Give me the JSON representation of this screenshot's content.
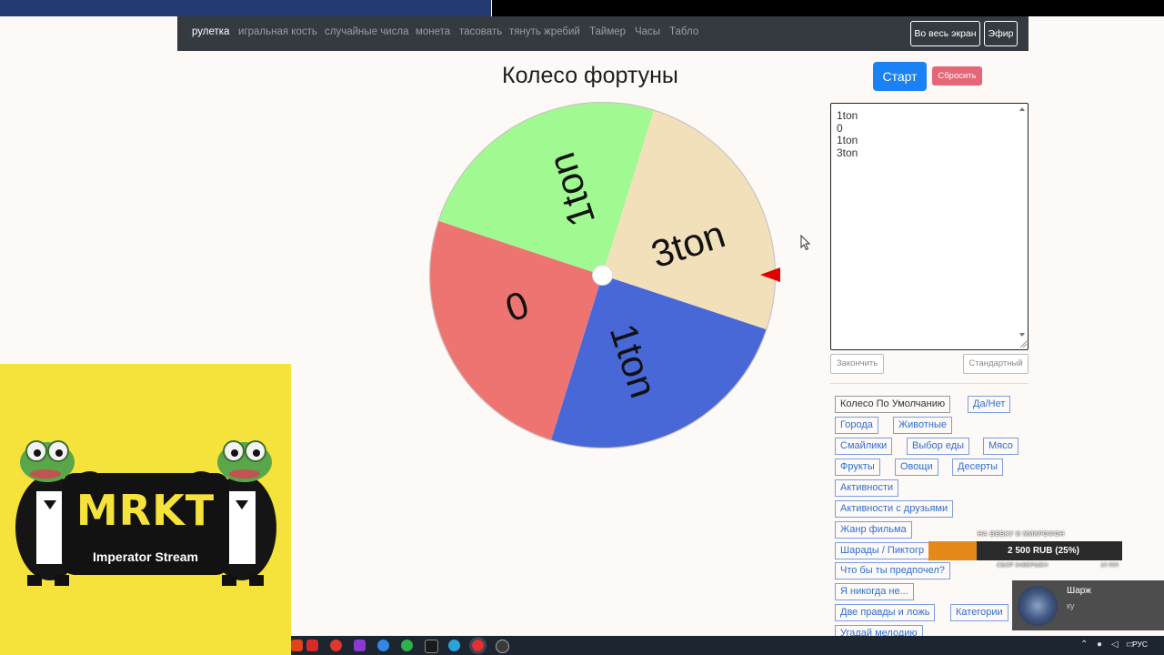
{
  "nav": {
    "links": [
      "рулетка",
      "игральная кость",
      "случайные числа",
      "монета",
      "тасовать",
      "тянуть жребий",
      "Таймер",
      "Часы",
      "Табло"
    ],
    "fullscreen_label": "Во весь экран",
    "air_label": "Эфир"
  },
  "page": {
    "title": "Колесо фортуны",
    "start_label": "Старт",
    "reset_label": "Сбросить"
  },
  "wheel": {
    "segments": [
      {
        "label": "3ton",
        "color": "#f2e0bb"
      },
      {
        "label": "1ton",
        "color": "#4868d8"
      },
      {
        "label": "0",
        "color": "#ee7472"
      },
      {
        "label": "1ton",
        "color": "#a0fa91"
      }
    ],
    "pointer_color": "#e00000"
  },
  "editor": {
    "lines": [
      "1ton",
      "0",
      "1ton",
      "3ton"
    ],
    "finish_label": "Закончить",
    "standard_label": "Стандартный"
  },
  "presets": [
    "Колесо По Умолчанию",
    "Да/Нет",
    "Города",
    "Животные",
    "Смайлики",
    "Выбор еды",
    "Мясо",
    "Фрукты",
    "Овощи",
    "Десерты",
    "Активности",
    "Активности с друзьями",
    "Жанр фильма",
    "Шарады / Пиктогр",
    "Что бы ты предпочел?",
    "Я никогда не...",
    "Две правды и ложь",
    "Категории",
    "Угадай мелодию"
  ],
  "stream": {
    "logo": "MRKT",
    "subtitle": "Imperator Stream",
    "donation_caption": "НА ВЕБКУ И МИКРОФОН",
    "donation_amount": "2 500 RUB (25%)",
    "donation_progress": 0.25,
    "donation_left": "СБОР ЗАВЕРШЕН",
    "donation_right": "10 000",
    "notif_title": "Шарж",
    "notif_text": "ку"
  },
  "taskbar": {
    "lang": "РУС"
  }
}
